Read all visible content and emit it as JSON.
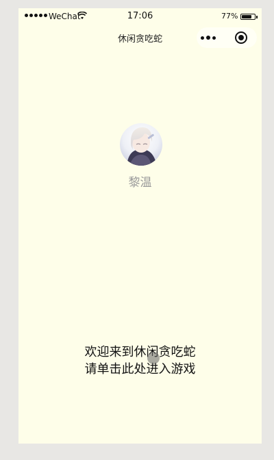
{
  "status_bar": {
    "carrier": "WeChat",
    "time": "17:06",
    "battery_percent": "77%",
    "battery_level": 0.77,
    "signal_dots": 5
  },
  "navbar": {
    "title": "休闲贪吃蛇",
    "more_icon": "more-dots-icon",
    "close_icon": "close-miniprogram-icon"
  },
  "profile": {
    "username": "黎温"
  },
  "prompt": {
    "line1": "欢迎来到休闲贪吃蛇",
    "line2": "请单击此处进入游戏"
  },
  "colors": {
    "page_background": "#fefee9",
    "outer_background": "#e8e7e4",
    "username_color": "#9a9a9a"
  }
}
